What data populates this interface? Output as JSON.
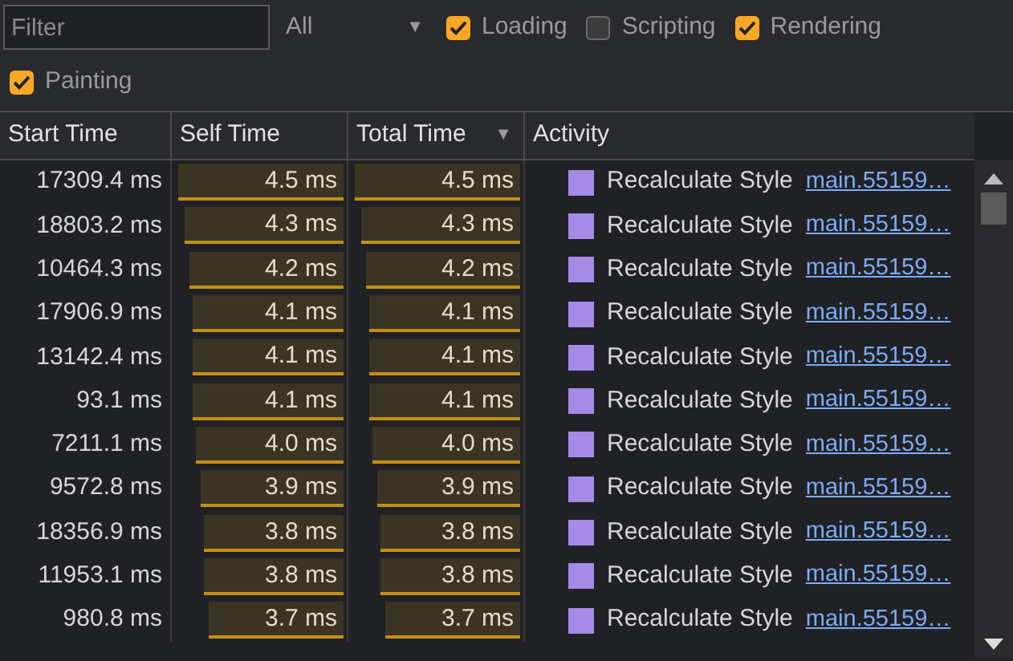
{
  "toolbar": {
    "filter": {
      "placeholder": "Filter"
    },
    "dropdown": {
      "value": "All",
      "arrow": "▼"
    },
    "checkboxes": [
      {
        "label": "Loading",
        "checked": true
      },
      {
        "label": "Scripting",
        "checked": false
      },
      {
        "label": "Rendering",
        "checked": true
      },
      {
        "label": "Painting",
        "checked": true
      }
    ]
  },
  "table": {
    "columns": [
      {
        "label": "Start Time"
      },
      {
        "label": "Self Time"
      },
      {
        "label": "Total Time",
        "sort": "▼"
      },
      {
        "label": "Activity"
      }
    ],
    "rows": [
      {
        "start": "17309.4 ms",
        "self": {
          "text": "4.5 ms",
          "level": 0.99
        },
        "total": {
          "text": "4.5 ms",
          "level": 0.99
        },
        "activity": "Recalculate Style",
        "link": "main.55159…"
      },
      {
        "start": "18803.2 ms",
        "self": {
          "text": "4.3 ms",
          "level": 0.95
        },
        "total": {
          "text": "4.3 ms",
          "level": 0.95
        },
        "activity": "Recalculate Style",
        "link": "main.55159…"
      },
      {
        "start": "10464.3 ms",
        "self": {
          "text": "4.2 ms",
          "level": 0.92
        },
        "total": {
          "text": "4.2 ms",
          "level": 0.92
        },
        "activity": "Recalculate Style",
        "link": "main.55159…"
      },
      {
        "start": "17906.9 ms",
        "self": {
          "text": "4.1 ms",
          "level": 0.9
        },
        "total": {
          "text": "4.1 ms",
          "level": 0.9
        },
        "activity": "Recalculate Style",
        "link": "main.55159…"
      },
      {
        "start": "13142.4 ms",
        "self": {
          "text": "4.1 ms",
          "level": 0.9
        },
        "total": {
          "text": "4.1 ms",
          "level": 0.9
        },
        "activity": "Recalculate Style",
        "link": "main.55159…"
      },
      {
        "start": "93.1 ms",
        "self": {
          "text": "4.1 ms",
          "level": 0.9
        },
        "total": {
          "text": "4.1 ms",
          "level": 0.9
        },
        "activity": "Recalculate Style",
        "link": "main.55159…"
      },
      {
        "start": "7211.1 ms",
        "self": {
          "text": "4.0 ms",
          "level": 0.88
        },
        "total": {
          "text": "4.0 ms",
          "level": 0.88
        },
        "activity": "Recalculate Style",
        "link": "main.55159…"
      },
      {
        "start": "9572.8 ms",
        "self": {
          "text": "3.9 ms",
          "level": 0.86
        },
        "total": {
          "text": "3.9 ms",
          "level": 0.86
        },
        "activity": "Recalculate Style",
        "link": "main.55159…"
      },
      {
        "start": "18356.9 ms",
        "self": {
          "text": "3.8 ms",
          "level": 0.84
        },
        "total": {
          "text": "3.8 ms",
          "level": 0.84
        },
        "activity": "Recalculate Style",
        "link": "main.55159…"
      },
      {
        "start": "11953.1 ms",
        "self": {
          "text": "3.8 ms",
          "level": 0.84
        },
        "total": {
          "text": "3.8 ms",
          "level": 0.84
        },
        "activity": "Recalculate Style",
        "link": "main.55159…"
      },
      {
        "start": "980.8 ms",
        "self": {
          "text": "3.7 ms",
          "level": 0.81
        },
        "total": {
          "text": "3.7 ms",
          "level": 0.81
        },
        "activity": "Recalculate Style",
        "link": "main.55159…"
      }
    ]
  }
}
